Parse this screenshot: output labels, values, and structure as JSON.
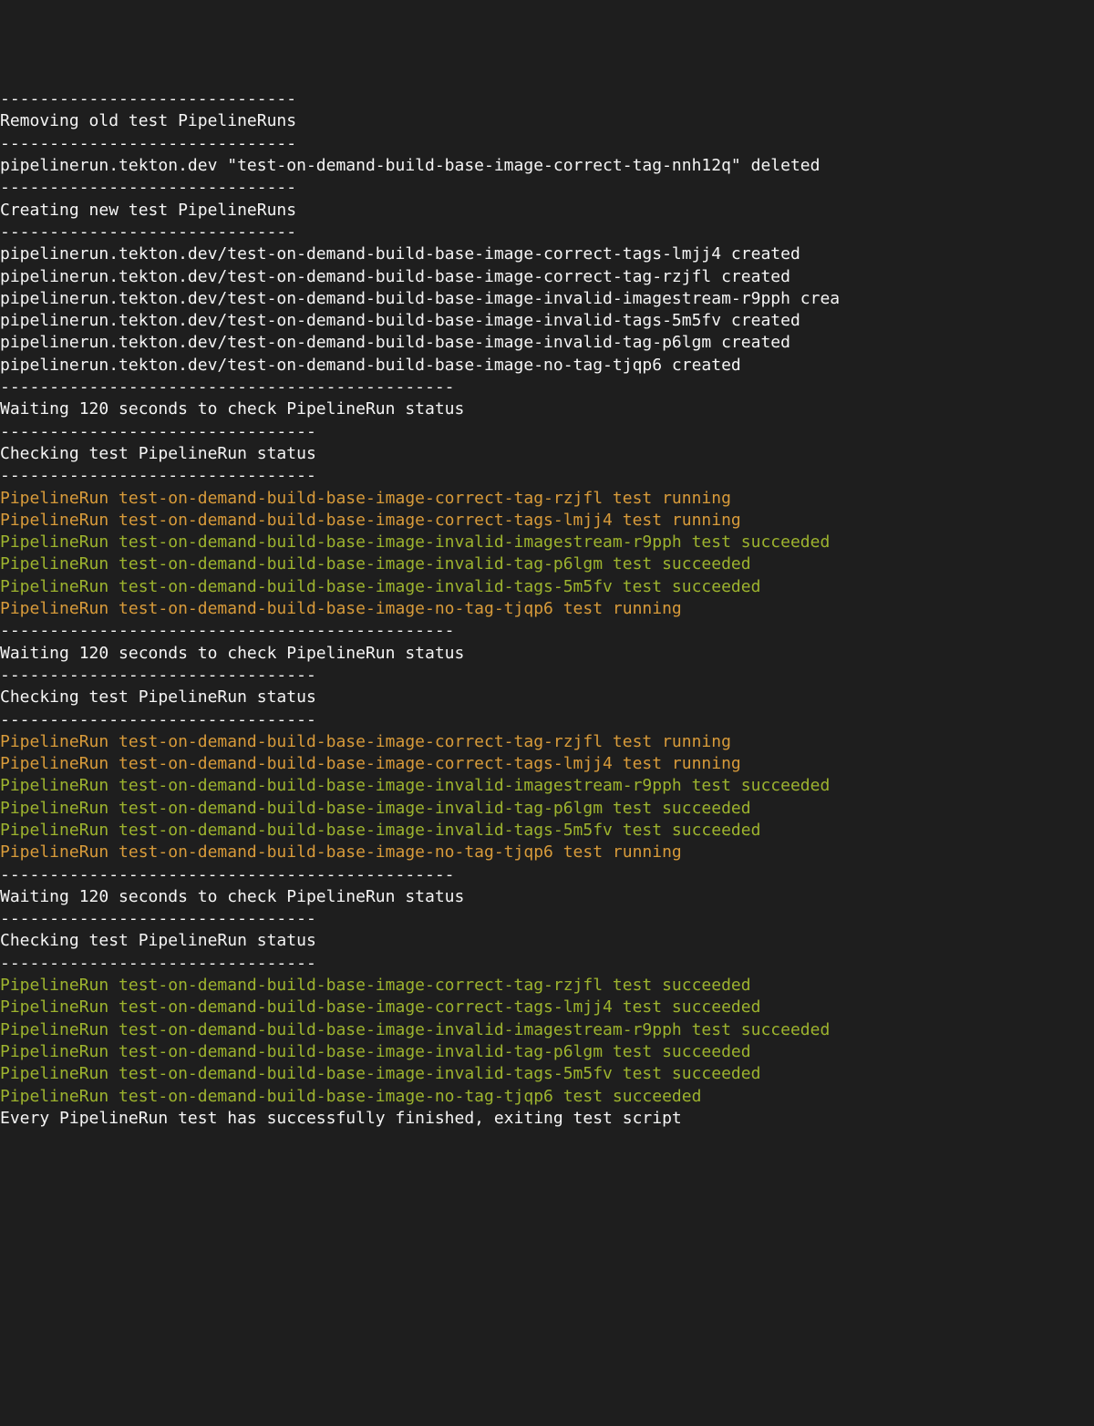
{
  "lines": [
    {
      "text": "------------------------------",
      "color": "white"
    },
    {
      "text": "Removing old test PipelineRuns",
      "color": "white"
    },
    {
      "text": "------------------------------",
      "color": "white"
    },
    {
      "text": "pipelinerun.tekton.dev \"test-on-demand-build-base-image-correct-tag-nnh12q\" deleted",
      "color": "white"
    },
    {
      "text": "",
      "color": "white"
    },
    {
      "text": "------------------------------",
      "color": "white"
    },
    {
      "text": "Creating new test PipelineRuns",
      "color": "white"
    },
    {
      "text": "------------------------------",
      "color": "white"
    },
    {
      "text": "pipelinerun.tekton.dev/test-on-demand-build-base-image-correct-tags-lmjj4 created",
      "color": "white"
    },
    {
      "text": "pipelinerun.tekton.dev/test-on-demand-build-base-image-correct-tag-rzjfl created",
      "color": "white"
    },
    {
      "text": "pipelinerun.tekton.dev/test-on-demand-build-base-image-invalid-imagestream-r9pph crea",
      "color": "white"
    },
    {
      "text": "pipelinerun.tekton.dev/test-on-demand-build-base-image-invalid-tags-5m5fv created",
      "color": "white"
    },
    {
      "text": "pipelinerun.tekton.dev/test-on-demand-build-base-image-invalid-tag-p6lgm created",
      "color": "white"
    },
    {
      "text": "pipelinerun.tekton.dev/test-on-demand-build-base-image-no-tag-tjqp6 created",
      "color": "white"
    },
    {
      "text": "",
      "color": "white"
    },
    {
      "text": "----------------------------------------------",
      "color": "white"
    },
    {
      "text": "Waiting 120 seconds to check PipelineRun status",
      "color": "white"
    },
    {
      "text": "--------------------------------",
      "color": "white"
    },
    {
      "text": "Checking test PipelineRun status",
      "color": "white"
    },
    {
      "text": "--------------------------------",
      "color": "white"
    },
    {
      "text": "PipelineRun test-on-demand-build-base-image-correct-tag-rzjfl test running",
      "color": "orange"
    },
    {
      "text": "PipelineRun test-on-demand-build-base-image-correct-tags-lmjj4 test running",
      "color": "orange"
    },
    {
      "text": "PipelineRun test-on-demand-build-base-image-invalid-imagestream-r9pph test succeeded",
      "color": "green"
    },
    {
      "text": "PipelineRun test-on-demand-build-base-image-invalid-tag-p6lgm test succeeded",
      "color": "green"
    },
    {
      "text": "PipelineRun test-on-demand-build-base-image-invalid-tags-5m5fv test succeeded",
      "color": "green"
    },
    {
      "text": "PipelineRun test-on-demand-build-base-image-no-tag-tjqp6 test running",
      "color": "orange"
    },
    {
      "text": "",
      "color": "white"
    },
    {
      "text": "----------------------------------------------",
      "color": "white"
    },
    {
      "text": "Waiting 120 seconds to check PipelineRun status",
      "color": "white"
    },
    {
      "text": "--------------------------------",
      "color": "white"
    },
    {
      "text": "Checking test PipelineRun status",
      "color": "white"
    },
    {
      "text": "--------------------------------",
      "color": "white"
    },
    {
      "text": "PipelineRun test-on-demand-build-base-image-correct-tag-rzjfl test running",
      "color": "orange"
    },
    {
      "text": "PipelineRun test-on-demand-build-base-image-correct-tags-lmjj4 test running",
      "color": "orange"
    },
    {
      "text": "PipelineRun test-on-demand-build-base-image-invalid-imagestream-r9pph test succeeded",
      "color": "green"
    },
    {
      "text": "PipelineRun test-on-demand-build-base-image-invalid-tag-p6lgm test succeeded",
      "color": "green"
    },
    {
      "text": "PipelineRun test-on-demand-build-base-image-invalid-tags-5m5fv test succeeded",
      "color": "green"
    },
    {
      "text": "PipelineRun test-on-demand-build-base-image-no-tag-tjqp6 test running",
      "color": "orange"
    },
    {
      "text": "",
      "color": "white"
    },
    {
      "text": "----------------------------------------------",
      "color": "white"
    },
    {
      "text": "Waiting 120 seconds to check PipelineRun status",
      "color": "white"
    },
    {
      "text": "--------------------------------",
      "color": "white"
    },
    {
      "text": "Checking test PipelineRun status",
      "color": "white"
    },
    {
      "text": "--------------------------------",
      "color": "white"
    },
    {
      "text": "PipelineRun test-on-demand-build-base-image-correct-tag-rzjfl test succeeded",
      "color": "green"
    },
    {
      "text": "PipelineRun test-on-demand-build-base-image-correct-tags-lmjj4 test succeeded",
      "color": "green"
    },
    {
      "text": "PipelineRun test-on-demand-build-base-image-invalid-imagestream-r9pph test succeeded",
      "color": "green"
    },
    {
      "text": "PipelineRun test-on-demand-build-base-image-invalid-tag-p6lgm test succeeded",
      "color": "green"
    },
    {
      "text": "PipelineRun test-on-demand-build-base-image-invalid-tags-5m5fv test succeeded",
      "color": "green"
    },
    {
      "text": "PipelineRun test-on-demand-build-base-image-no-tag-tjqp6 test succeeded",
      "color": "green"
    },
    {
      "text": "",
      "color": "white"
    },
    {
      "text": "Every PipelineRun test has successfully finished, exiting test script",
      "color": "white"
    }
  ]
}
